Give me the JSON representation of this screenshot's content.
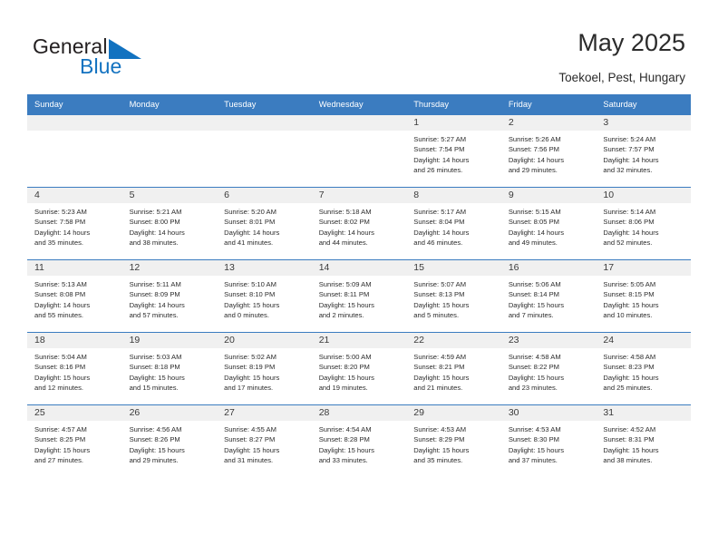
{
  "brand": {
    "name_part1": "General",
    "name_part2": "Blue",
    "accent_color": "#1272c0"
  },
  "header": {
    "title": "May 2025",
    "subtitle": "Toekoel, Pest, Hungary",
    "header_bg_color": "#3b7cc0"
  },
  "weekdays": [
    "Sunday",
    "Monday",
    "Tuesday",
    "Wednesday",
    "Thursday",
    "Friday",
    "Saturday"
  ],
  "weeks": [
    [
      {
        "day": "",
        "empty": true,
        "sunrise": "",
        "sunset": "",
        "daylight1": "",
        "daylight2": ""
      },
      {
        "day": "",
        "empty": true,
        "sunrise": "",
        "sunset": "",
        "daylight1": "",
        "daylight2": ""
      },
      {
        "day": "",
        "empty": true,
        "sunrise": "",
        "sunset": "",
        "daylight1": "",
        "daylight2": ""
      },
      {
        "day": "",
        "empty": true,
        "sunrise": "",
        "sunset": "",
        "daylight1": "",
        "daylight2": ""
      },
      {
        "day": "1",
        "sunrise": "Sunrise: 5:27 AM",
        "sunset": "Sunset: 7:54 PM",
        "daylight1": "Daylight: 14 hours",
        "daylight2": "and 26 minutes."
      },
      {
        "day": "2",
        "sunrise": "Sunrise: 5:26 AM",
        "sunset": "Sunset: 7:56 PM",
        "daylight1": "Daylight: 14 hours",
        "daylight2": "and 29 minutes."
      },
      {
        "day": "3",
        "sunrise": "Sunrise: 5:24 AM",
        "sunset": "Sunset: 7:57 PM",
        "daylight1": "Daylight: 14 hours",
        "daylight2": "and 32 minutes."
      }
    ],
    [
      {
        "day": "4",
        "sunrise": "Sunrise: 5:23 AM",
        "sunset": "Sunset: 7:58 PM",
        "daylight1": "Daylight: 14 hours",
        "daylight2": "and 35 minutes."
      },
      {
        "day": "5",
        "sunrise": "Sunrise: 5:21 AM",
        "sunset": "Sunset: 8:00 PM",
        "daylight1": "Daylight: 14 hours",
        "daylight2": "and 38 minutes."
      },
      {
        "day": "6",
        "sunrise": "Sunrise: 5:20 AM",
        "sunset": "Sunset: 8:01 PM",
        "daylight1": "Daylight: 14 hours",
        "daylight2": "and 41 minutes."
      },
      {
        "day": "7",
        "sunrise": "Sunrise: 5:18 AM",
        "sunset": "Sunset: 8:02 PM",
        "daylight1": "Daylight: 14 hours",
        "daylight2": "and 44 minutes."
      },
      {
        "day": "8",
        "sunrise": "Sunrise: 5:17 AM",
        "sunset": "Sunset: 8:04 PM",
        "daylight1": "Daylight: 14 hours",
        "daylight2": "and 46 minutes."
      },
      {
        "day": "9",
        "sunrise": "Sunrise: 5:15 AM",
        "sunset": "Sunset: 8:05 PM",
        "daylight1": "Daylight: 14 hours",
        "daylight2": "and 49 minutes."
      },
      {
        "day": "10",
        "sunrise": "Sunrise: 5:14 AM",
        "sunset": "Sunset: 8:06 PM",
        "daylight1": "Daylight: 14 hours",
        "daylight2": "and 52 minutes."
      }
    ],
    [
      {
        "day": "11",
        "sunrise": "Sunrise: 5:13 AM",
        "sunset": "Sunset: 8:08 PM",
        "daylight1": "Daylight: 14 hours",
        "daylight2": "and 55 minutes."
      },
      {
        "day": "12",
        "sunrise": "Sunrise: 5:11 AM",
        "sunset": "Sunset: 8:09 PM",
        "daylight1": "Daylight: 14 hours",
        "daylight2": "and 57 minutes."
      },
      {
        "day": "13",
        "sunrise": "Sunrise: 5:10 AM",
        "sunset": "Sunset: 8:10 PM",
        "daylight1": "Daylight: 15 hours",
        "daylight2": "and 0 minutes."
      },
      {
        "day": "14",
        "sunrise": "Sunrise: 5:09 AM",
        "sunset": "Sunset: 8:11 PM",
        "daylight1": "Daylight: 15 hours",
        "daylight2": "and 2 minutes."
      },
      {
        "day": "15",
        "sunrise": "Sunrise: 5:07 AM",
        "sunset": "Sunset: 8:13 PM",
        "daylight1": "Daylight: 15 hours",
        "daylight2": "and 5 minutes."
      },
      {
        "day": "16",
        "sunrise": "Sunrise: 5:06 AM",
        "sunset": "Sunset: 8:14 PM",
        "daylight1": "Daylight: 15 hours",
        "daylight2": "and 7 minutes."
      },
      {
        "day": "17",
        "sunrise": "Sunrise: 5:05 AM",
        "sunset": "Sunset: 8:15 PM",
        "daylight1": "Daylight: 15 hours",
        "daylight2": "and 10 minutes."
      }
    ],
    [
      {
        "day": "18",
        "sunrise": "Sunrise: 5:04 AM",
        "sunset": "Sunset: 8:16 PM",
        "daylight1": "Daylight: 15 hours",
        "daylight2": "and 12 minutes."
      },
      {
        "day": "19",
        "sunrise": "Sunrise: 5:03 AM",
        "sunset": "Sunset: 8:18 PM",
        "daylight1": "Daylight: 15 hours",
        "daylight2": "and 15 minutes."
      },
      {
        "day": "20",
        "sunrise": "Sunrise: 5:02 AM",
        "sunset": "Sunset: 8:19 PM",
        "daylight1": "Daylight: 15 hours",
        "daylight2": "and 17 minutes."
      },
      {
        "day": "21",
        "sunrise": "Sunrise: 5:00 AM",
        "sunset": "Sunset: 8:20 PM",
        "daylight1": "Daylight: 15 hours",
        "daylight2": "and 19 minutes."
      },
      {
        "day": "22",
        "sunrise": "Sunrise: 4:59 AM",
        "sunset": "Sunset: 8:21 PM",
        "daylight1": "Daylight: 15 hours",
        "daylight2": "and 21 minutes."
      },
      {
        "day": "23",
        "sunrise": "Sunrise: 4:58 AM",
        "sunset": "Sunset: 8:22 PM",
        "daylight1": "Daylight: 15 hours",
        "daylight2": "and 23 minutes."
      },
      {
        "day": "24",
        "sunrise": "Sunrise: 4:58 AM",
        "sunset": "Sunset: 8:23 PM",
        "daylight1": "Daylight: 15 hours",
        "daylight2": "and 25 minutes."
      }
    ],
    [
      {
        "day": "25",
        "sunrise": "Sunrise: 4:57 AM",
        "sunset": "Sunset: 8:25 PM",
        "daylight1": "Daylight: 15 hours",
        "daylight2": "and 27 minutes."
      },
      {
        "day": "26",
        "sunrise": "Sunrise: 4:56 AM",
        "sunset": "Sunset: 8:26 PM",
        "daylight1": "Daylight: 15 hours",
        "daylight2": "and 29 minutes."
      },
      {
        "day": "27",
        "sunrise": "Sunrise: 4:55 AM",
        "sunset": "Sunset: 8:27 PM",
        "daylight1": "Daylight: 15 hours",
        "daylight2": "and 31 minutes."
      },
      {
        "day": "28",
        "sunrise": "Sunrise: 4:54 AM",
        "sunset": "Sunset: 8:28 PM",
        "daylight1": "Daylight: 15 hours",
        "daylight2": "and 33 minutes."
      },
      {
        "day": "29",
        "sunrise": "Sunrise: 4:53 AM",
        "sunset": "Sunset: 8:29 PM",
        "daylight1": "Daylight: 15 hours",
        "daylight2": "and 35 minutes."
      },
      {
        "day": "30",
        "sunrise": "Sunrise: 4:53 AM",
        "sunset": "Sunset: 8:30 PM",
        "daylight1": "Daylight: 15 hours",
        "daylight2": "and 37 minutes."
      },
      {
        "day": "31",
        "sunrise": "Sunrise: 4:52 AM",
        "sunset": "Sunset: 8:31 PM",
        "daylight1": "Daylight: 15 hours",
        "daylight2": "and 38 minutes."
      }
    ]
  ]
}
